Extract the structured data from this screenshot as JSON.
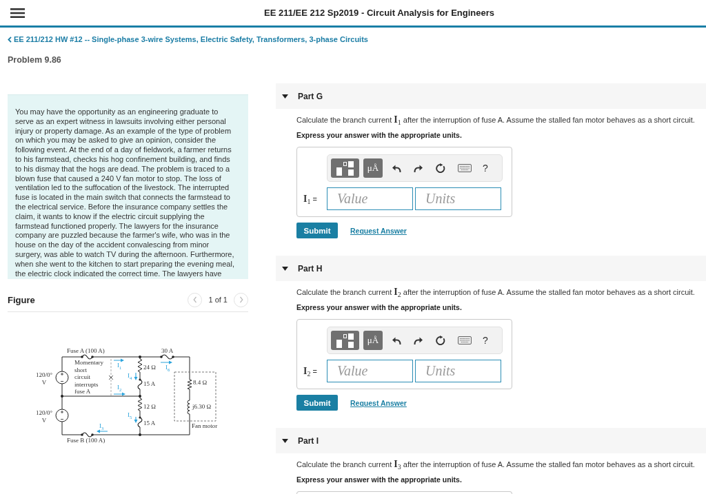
{
  "top_bar": {
    "title": "EE 211/EE 212 Sp2019 - Circuit Analysis for Engineers"
  },
  "breadcrumb": {
    "label": "EE 211/212 HW #12 -- Single-phase 3-wire Systems, Electric Safety, Transformers, 3-phase Circuits"
  },
  "problem_title": "Problem 9.86",
  "intro": "You may have the opportunity as an engineering graduate to serve as an expert witness in lawsuits involving either personal injury or property damage. As an example of the type of problem on which you may be asked to give an opinion, consider the following event. At the end of a day of fieldwork, a farmer returns to his farmstead, checks his hog confinement building, and finds to his dismay that the hogs are dead. The problem is traced to a blown fuse that caused a 240 V fan motor to stop. The loss of ventilation led to the suffocation of the livestock. The interrupted fuse is located in the main switch that connects the farmstead to the electrical service. Before the insurance company settles the claim, it wants to know if the electric circuit supplying the farmstead functioned properly. The lawyers for the insurance company are puzzled because the farmer's wife, who was in the house on the day of the accident convalescing from minor surgery, was able to watch TV during the afternoon. Furthermore, when she went to the kitchen to start preparing the evening meal, the electric clock indicated the correct time. The lawyers have",
  "figure": {
    "heading": "Figure",
    "pager": {
      "label": "1 of 1",
      "buttons": [
        {
          "kind": "previous",
          "disabled": true
        },
        {
          "kind": "next",
          "disabled": true
        }
      ]
    },
    "labels": [
      {
        "text": "Fuse A (100 A)",
        "kind": "text"
      },
      {
        "text": "30 A",
        "kind": "text"
      },
      {
        "text": "120/0°\nV",
        "kind": "text"
      },
      {
        "text": "Momentary\nshort\ncircuit\ninterrupts\nfuse A",
        "kind": "text"
      },
      {
        "text": "I$_{1}$",
        "kind": "current"
      },
      {
        "text": "24 Ω",
        "kind": "text"
      },
      {
        "text": "I$_{6}$",
        "kind": "current"
      },
      {
        "text": "I$_{4}$",
        "kind": "current"
      },
      {
        "text": "I$_{2}$",
        "kind": "current"
      },
      {
        "text": "15 A",
        "kind": "text"
      },
      {
        "text": "8.4 Ω",
        "kind": "text"
      },
      {
        "text": "120/0°\nV",
        "kind": "text"
      },
      {
        "text": "12 Ω",
        "kind": "text"
      },
      {
        "text": "j6.30 Ω",
        "kind": "text"
      },
      {
        "text": "I$_{5}$",
        "kind": "current"
      },
      {
        "text": "I$_{3}$",
        "kind": "current"
      },
      {
        "text": "15 A",
        "kind": "text"
      },
      {
        "text": "Fan motor",
        "kind": "text"
      },
      {
        "text": "Fuse B (100 A)",
        "kind": "text"
      }
    ]
  },
  "parts": [
    {
      "title": "Part G",
      "expanded": true,
      "question": "Calculate the branch current **I**$_{1}$ after the interruption of fuse A. Assume the stalled fan motor behaves as a short circuit.",
      "instruction": "Express your answer with the appropriate units.",
      "answer": {
        "toolbar": {
          "units_button": "μÅ",
          "help": "?"
        },
        "label": "**I**$_{1}$ =",
        "value_placeholder": "Value",
        "units_placeholder": "Units"
      },
      "submit": "Submit",
      "request_answer": "Request Answer"
    },
    {
      "title": "Part H",
      "expanded": true,
      "question": "Calculate the branch current **I**$_{2}$ after the interruption of fuse A. Assume the stalled fan motor behaves as a short circuit.",
      "instruction": "Express your answer with the appropriate units.",
      "answer": {
        "toolbar": {
          "units_button": "μÅ",
          "help": "?"
        },
        "label": "**I**$_{2}$ =",
        "value_placeholder": "Value",
        "units_placeholder": "Units"
      },
      "submit": "Submit",
      "request_answer": "Request Answer"
    },
    {
      "title": "Part I",
      "expanded": true,
      "question": "Calculate the branch current **I**$_{3}$ after the interruption of fuse A. Assume the stalled fan motor behaves as a short circuit.",
      "instruction": "Express your answer with the appropriate units."
    }
  ]
}
